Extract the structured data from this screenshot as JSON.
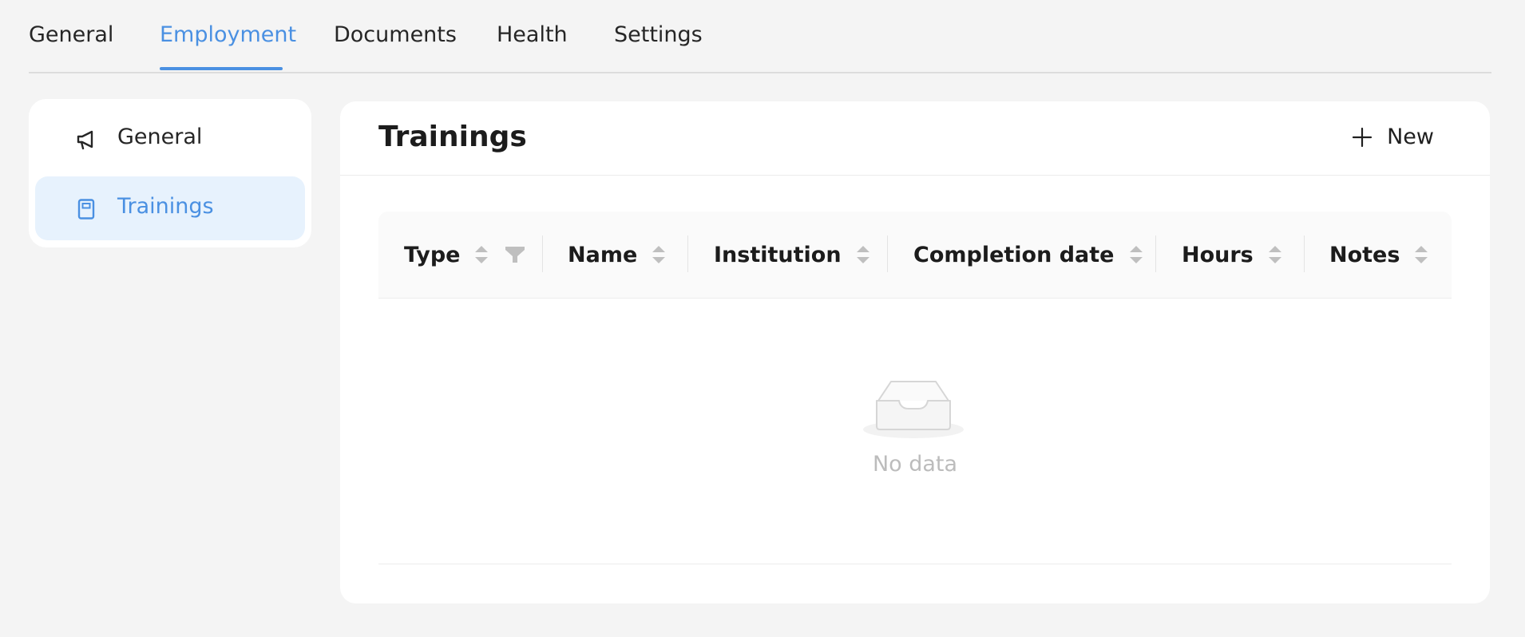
{
  "tabs": [
    {
      "label": "General"
    },
    {
      "label": "Employment"
    },
    {
      "label": "Documents"
    },
    {
      "label": "Health"
    },
    {
      "label": "Settings"
    }
  ],
  "active_tab": "Employment",
  "sidebar": {
    "items": [
      {
        "label": "General",
        "icon": "megaphone-icon"
      },
      {
        "label": "Trainings",
        "icon": "book-icon"
      }
    ],
    "selected": "Trainings"
  },
  "panel": {
    "title": "Trainings",
    "new_button_label": "New"
  },
  "table": {
    "columns": [
      {
        "label": "Type",
        "sortable": true,
        "filterable": true
      },
      {
        "label": "Name",
        "sortable": true
      },
      {
        "label": "Institution",
        "sortable": true
      },
      {
        "label": "Completion date",
        "sortable": true
      },
      {
        "label": "Hours",
        "sortable": true
      },
      {
        "label": "Notes",
        "sortable": true
      }
    ],
    "rows": [],
    "empty_text": "No data"
  },
  "colors": {
    "accent": "#4a90e2",
    "page_background": "#f4f4f4",
    "selected_background": "#e7f2fd",
    "muted_text": "#bcbcbc"
  }
}
